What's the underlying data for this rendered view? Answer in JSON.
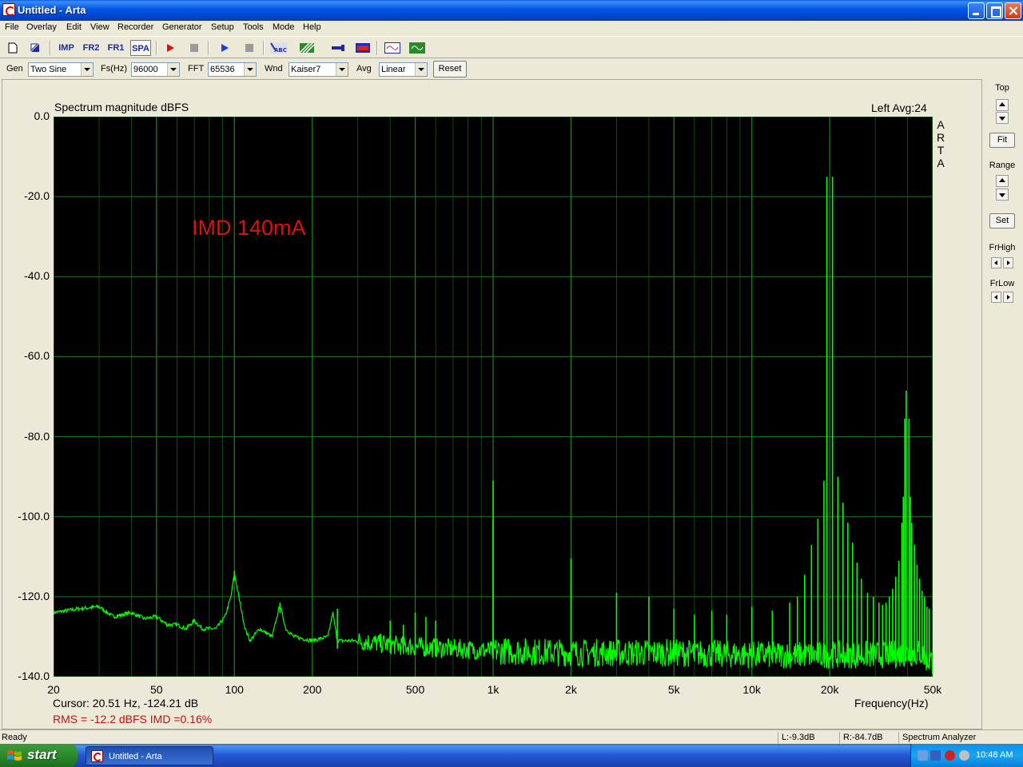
{
  "window": {
    "title": "Untitled - Arta"
  },
  "menu": [
    "File",
    "Overlay",
    "Edit",
    "View",
    "Recorder",
    "Generator",
    "Setup",
    "Tools",
    "Mode",
    "Help"
  ],
  "toolbar": {
    "imp": "IMP",
    "fr2": "FR2",
    "fr1": "FR1",
    "spa": "SPA",
    "abc": "ABC"
  },
  "params": {
    "gen_label": "Gen",
    "gen_value": "Two Sine",
    "fs_label": "Fs(Hz)",
    "fs_value": "96000",
    "fft_label": "FFT",
    "fft_value": "65536",
    "wnd_label": "Wnd",
    "wnd_value": "Kaiser7",
    "avg_label": "Avg",
    "avg_value": "Linear",
    "reset": "Reset"
  },
  "plot": {
    "title": "Spectrum magnitude dBFS",
    "info": "Left  Avg:24",
    "logo": [
      "A",
      "R",
      "T",
      "A"
    ],
    "annotation": "IMD 140mA",
    "cursor": "Cursor: 20.51 Hz, -124.21 dB",
    "rms": "RMS =  -12.2 dBFS   IMD =0.16%"
  },
  "side": {
    "top": "Top",
    "fit": "Fit",
    "range": "Range",
    "set": "Set",
    "frhigh": "FrHigh",
    "frlow": "FrLow"
  },
  "status": {
    "ready": "Ready",
    "left": "L:-9.3dB",
    "right": "R:-84.7dB",
    "mode": "Spectrum Analyzer"
  },
  "taskbar": {
    "start": "start",
    "task": "Untitled - Arta",
    "clock": "10:48 AM"
  },
  "chart_data": {
    "type": "line",
    "title": "Spectrum magnitude dBFS",
    "xlabel": "Frequency(Hz)",
    "ylabel": "",
    "x_scale": "log",
    "xlim": [
      20,
      50000
    ],
    "ylim": [
      -140,
      0
    ],
    "grid": true,
    "x_ticks": [
      20,
      50,
      100,
      200,
      500,
      1000,
      2000,
      5000,
      10000,
      20000,
      50000
    ],
    "x_tick_labels": [
      "20",
      "50",
      "100",
      "200",
      "500",
      "1k",
      "2k",
      "5k",
      "10k",
      "20k",
      "50k"
    ],
    "y_ticks": [
      0,
      -20,
      -40,
      -60,
      -80,
      -100,
      -120,
      -140
    ],
    "y_tick_labels": [
      "0.0",
      "-20.0",
      "-40.0",
      "-60.0",
      "-80.0",
      "-100.0",
      "-120.0",
      "-140.0"
    ],
    "line_color": "#00ff00",
    "grid_color": "#1f7a1f",
    "noise_floor": [
      [
        20,
        -124
      ],
      [
        25,
        -123
      ],
      [
        30,
        -122.5
      ],
      [
        34,
        -125
      ],
      [
        40,
        -124
      ],
      [
        45,
        -125.5
      ],
      [
        50,
        -125
      ],
      [
        55,
        -127
      ],
      [
        60,
        -127
      ],
      [
        65,
        -128
      ],
      [
        70,
        -126
      ],
      [
        75,
        -128
      ],
      [
        85,
        -128
      ],
      [
        92,
        -125
      ],
      [
        97,
        -120
      ],
      [
        100,
        -114
      ],
      [
        104,
        -120
      ],
      [
        110,
        -128
      ],
      [
        115,
        -131
      ],
      [
        125,
        -128
      ],
      [
        140,
        -130
      ],
      [
        150,
        -122
      ],
      [
        158,
        -128
      ],
      [
        170,
        -130
      ],
      [
        200,
        -131
      ],
      [
        230,
        -130
      ],
      [
        240,
        -124
      ],
      [
        250,
        -131
      ],
      [
        300,
        -131
      ],
      [
        400,
        -132
      ],
      [
        500,
        -132.5
      ],
      [
        700,
        -133
      ],
      [
        1000,
        -133.5
      ],
      [
        2000,
        -134
      ],
      [
        5000,
        -134
      ],
      [
        10000,
        -134.5
      ],
      [
        20000,
        -134.5
      ],
      [
        30000,
        -134.5
      ],
      [
        45000,
        -134
      ],
      [
        48000,
        -136
      ]
    ],
    "peaks": [
      [
        100,
        -113.5
      ],
      [
        150,
        -121.5
      ],
      [
        250,
        -123
      ],
      [
        400,
        -126
      ],
      [
        450,
        -127
      ],
      [
        500,
        -124
      ],
      [
        550,
        -125
      ],
      [
        600,
        -126
      ],
      [
        1000,
        -91
      ],
      [
        1000,
        -101
      ],
      [
        2000,
        -110.5
      ],
      [
        3000,
        -119
      ],
      [
        4000,
        -120
      ],
      [
        5000,
        -123
      ],
      [
        6000,
        -124.5
      ],
      [
        7000,
        -123.5
      ],
      [
        8000,
        -124.5
      ],
      [
        10000,
        -122.5
      ],
      [
        12000,
        -123.5
      ],
      [
        14000,
        -121.5
      ],
      [
        15000,
        -120
      ],
      [
        16000,
        -114.5
      ],
      [
        17000,
        -107
      ],
      [
        18000,
        -100.5
      ],
      [
        19000,
        -91
      ],
      [
        19500,
        -15
      ],
      [
        20500,
        -15
      ],
      [
        21500,
        -90
      ],
      [
        22500,
        -96.5
      ],
      [
        23500,
        -101.5
      ],
      [
        24500,
        -106.5
      ],
      [
        25500,
        -111.5
      ],
      [
        26500,
        -115.5
      ],
      [
        28000,
        -119
      ],
      [
        29500,
        -120
      ],
      [
        31000,
        -121.5
      ],
      [
        32000,
        -122
      ],
      [
        33000,
        -121.5
      ],
      [
        34000,
        -120
      ],
      [
        35000,
        -118
      ],
      [
        36000,
        -115
      ],
      [
        37000,
        -111
      ],
      [
        38000,
        -101.5
      ],
      [
        38500,
        -95
      ],
      [
        39000,
        -75.5
      ],
      [
        39500,
        -68.5
      ],
      [
        40500,
        -75.5
      ],
      [
        41000,
        -95
      ],
      [
        41500,
        -101.5
      ],
      [
        42500,
        -107
      ],
      [
        43500,
        -112
      ],
      [
        44500,
        -115.5
      ],
      [
        45500,
        -118.5
      ],
      [
        46500,
        -120
      ],
      [
        47500,
        -122.5
      ],
      [
        48500,
        -123
      ]
    ]
  }
}
